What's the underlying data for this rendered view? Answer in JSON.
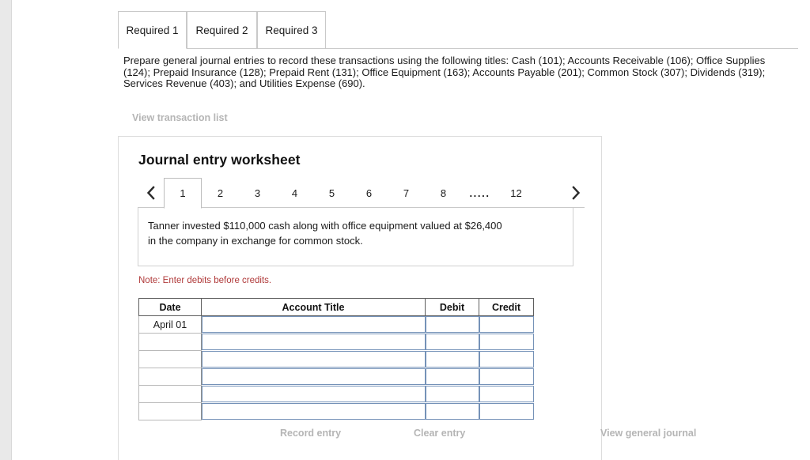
{
  "tabs": [
    {
      "label": "Required 1",
      "active": true
    },
    {
      "label": "Required 2",
      "active": false
    },
    {
      "label": "Required 3",
      "active": false
    }
  ],
  "instructions": "Prepare general journal entries to record these transactions using the following titles: Cash (101); Accounts Receivable (106); Office Supplies (124); Prepaid Insurance (128); Prepaid Rent (131); Office Equipment (163); Accounts Payable (201); Common Stock (307); Dividends (319); Services Revenue (403); and Utilities Expense (690).",
  "links": {
    "view_transaction_list": "View transaction list"
  },
  "worksheet": {
    "title": "Journal entry worksheet",
    "pager": {
      "prev_icon": "chevron-left-icon",
      "next_icon": "chevron-right-icon",
      "pages": [
        "1",
        "2",
        "3",
        "4",
        "5",
        "6",
        "7",
        "8",
        ".....",
        "12"
      ],
      "active_page": "1"
    },
    "transaction": {
      "line1": "Tanner invested $110,000 cash along with office equipment valued at $26,400",
      "line2": "in the company in exchange for common stock."
    },
    "note": "Note: Enter debits before credits.",
    "note_color": "#b03a3a",
    "table": {
      "headers": [
        "Date",
        "Account Title",
        "Debit",
        "Credit"
      ],
      "rows": [
        {
          "date": "April 01",
          "account_title": "",
          "debit": "",
          "credit": ""
        },
        {
          "date": "",
          "account_title": "",
          "debit": "",
          "credit": ""
        },
        {
          "date": "",
          "account_title": "",
          "debit": "",
          "credit": ""
        },
        {
          "date": "",
          "account_title": "",
          "debit": "",
          "credit": ""
        },
        {
          "date": "",
          "account_title": "",
          "debit": "",
          "credit": ""
        },
        {
          "date": "",
          "account_title": "",
          "debit": "",
          "credit": ""
        }
      ]
    },
    "footer": {
      "record_entry": "Record entry",
      "clear_entry": "Clear entry",
      "view_general_journal": "View general journal"
    }
  }
}
